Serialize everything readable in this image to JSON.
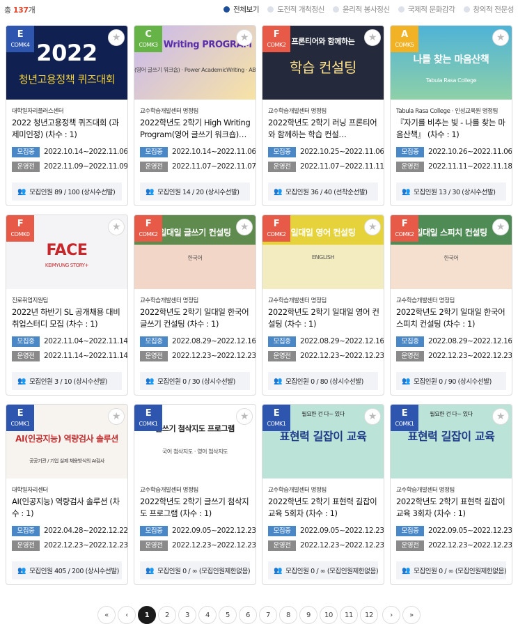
{
  "header": {
    "total_prefix": "총",
    "total_count": "137",
    "total_suffix": "개",
    "filters": [
      "전체보기",
      "도전적 개척정신",
      "윤리적 봉사정신",
      "국제적 문화감각",
      "창의적 전문성"
    ],
    "active_filter": 0
  },
  "labels": {
    "recruit": "모집중",
    "operate": "운영전",
    "count_prefix": "모집인원"
  },
  "colors": {
    "grade_E": "#2f56ae",
    "grade_C": "#66b347",
    "grade_F": "#e85a48",
    "grade_A": "#f2b226",
    "accent": "#e0452b",
    "active_dot": "#1d4e9a",
    "recruit_label": "#4a87c7",
    "operate_label": "#8a8a8a"
  },
  "icons": {
    "favorite": "star-icon",
    "person": "person-icon",
    "first": "double-chevron-left-icon",
    "prev": "chevron-left-icon",
    "next": "chevron-right-icon",
    "last": "double-chevron-right-icon"
  },
  "cards": [
    {
      "grade": "E",
      "code": "COMK4",
      "thumb": {
        "line1": "2022",
        "line2": "청년고용정책 퀴즈대회"
      },
      "org": "대학일자리플러스센터",
      "title": "2022 청년고용정책 퀴즈대회 (과제미인정) (차수 : 1)",
      "recruit": "2022.10.14~2022.11.06",
      "operate": "2022.11.09~2022.11.09",
      "count": "89 / 100 (상시수선발)"
    },
    {
      "grade": "C",
      "code": "COMK3",
      "thumb": {
        "line1": "High Writing PROGRAM",
        "line2": "(영어 글쓰기 워크숍) · Power AcademicWriting · ABCD"
      },
      "org": "교수학습개발센터 명정팀",
      "title": "2022학년도 2학기 High Writing Program(영어 글쓰기 워크숍)…",
      "recruit": "2022.10.14~2022.11.06",
      "operate": "2022.11.07~2022.11.07",
      "count": "14 / 20 (상시수선발)"
    },
    {
      "grade": "F",
      "code": "COMK2",
      "thumb": {
        "line1": "프론티어와 함께하는",
        "line2": "학습 컨설팅"
      },
      "org": "교수학습개발센터 명정팀",
      "title": "2022학년도 2학기 러닝 프론티어와 함께하는 학습 컨설…",
      "recruit": "2022.10.25~2022.11.06",
      "operate": "2022.11.07~2022.11.11",
      "count": "36 / 40 (선착순선발)"
    },
    {
      "grade": "A",
      "code": "COMK5",
      "thumb": {
        "line1": "나를 찾는 마음산책",
        "line2": "Tabula Rasa College"
      },
      "org": "Tabula Rasa College · 인성교육원 명정팀",
      "title": "『자기를 비추는 빛 - 나를 찾는 마음산책』 (차수 : 1)",
      "recruit": "2022.10.26~2022.11.06",
      "operate": "2022.11.11~2022.11.18",
      "count": "13 / 30 (상시수선발)"
    },
    {
      "grade": "F",
      "code": "COMK0",
      "thumb": {
        "line1": "FACE",
        "line2": "KEIMYUNG STORY+"
      },
      "org": "진로취업지원팀",
      "title": "2022년 하반기 SL 공개채용 대비 취업스터디 모집 (차수 : 1)",
      "recruit": "2022.11.04~2022.11.14",
      "operate": "2022.11.14~2022.11.14",
      "count": "3 / 10 (상시수선발)"
    },
    {
      "grade": "F",
      "code": "COMK2",
      "thumb": {
        "line1": "일대일 글쓰기 컨설팅",
        "line2": "한국어"
      },
      "org": "교수학습개발센터 명정팀",
      "title": "2022학년도 2학기 일대일 한국어 글쓰기 컨설팅 (차수 : 1)",
      "recruit": "2022.08.29~2022.12.16",
      "operate": "2022.12.23~2022.12.23",
      "count": "0 / 30 (상시수선발)"
    },
    {
      "grade": "F",
      "code": "COMK2",
      "thumb": {
        "line1": "일대일 영어 컨설팅",
        "line2": "ENGLISH"
      },
      "org": "교수학습개발센터 명정팀",
      "title": "2022학년도 2학기 일대일 영어 컨설팅 (차수 : 1)",
      "recruit": "2022.08.29~2022.12.16",
      "operate": "2022.12.23~2022.12.23",
      "count": "0 / 80 (상시수선발)"
    },
    {
      "grade": "F",
      "code": "COMK2",
      "thumb": {
        "line1": "일대일 스피치 컨설팅",
        "line2": "한국어"
      },
      "org": "교수학습개발센터 명정팀",
      "title": "2022학년도 2학기 일대일 한국어 스피치 컨설팅 (차수 : 1)",
      "recruit": "2022.08.29~2022.12.16",
      "operate": "2022.12.23~2022.12.23",
      "count": "0 / 90 (상시수선발)"
    },
    {
      "grade": "E",
      "code": "COMK1",
      "thumb": {
        "line1": "AI(인공지능) 역량검사 솔루션",
        "line2": "공공기관 / 기업 실제 채용방식의 AI검사"
      },
      "org": "대학일자리센터",
      "title": "AI(인공지능) 역량검사 솔루션 (차수 : 1)",
      "recruit": "2022.04.28~2022.12.22",
      "operate": "2022.12.23~2022.12.23",
      "count": "405 / 200 (상시수선발)"
    },
    {
      "grade": "E",
      "code": "COMK1",
      "thumb": {
        "line1": "글쓰기 첨삭지도 프로그램",
        "line2": "국어 첨삭지도 · 영어 첨삭지도"
      },
      "org": "교수학습개발센터 명정팀",
      "title": "2022학년도 2학기 글쓰기 첨삭지도 프로그램 (차수 : 1)",
      "recruit": "2022.09.05~2022.12.23",
      "operate": "2022.12.23~2022.12.23",
      "count": "0 / ∞ (모집인원제한없음)"
    },
    {
      "grade": "E",
      "code": "COMK1",
      "thumb": {
        "line1": "표현력 길잡이 교육",
        "line2": "필요한 건 다~ 있다"
      },
      "org": "교수학습개발센터 명정팀",
      "title": "2022학년도 2학기 표현력 길잡이 교육 5회차 (차수 : 1)",
      "recruit": "2022.09.05~2022.12.23",
      "operate": "2022.12.23~2022.12.23",
      "count": "0 / ∞ (모집인원제한없음)"
    },
    {
      "grade": "E",
      "code": "COMK1",
      "thumb": {
        "line1": "표현력 길잡이 교육",
        "line2": "필요한 건 다~ 있다"
      },
      "org": "교수학습개발센터 명정팀",
      "title": "2022학년도 2학기 표현력 길잡이 교육 3회차 (차수 : 1)",
      "recruit": "2022.09.05~2022.12.23",
      "operate": "2022.12.23~2022.12.23",
      "count": "0 / ∞ (모집인원제한없음)"
    }
  ],
  "pagination": {
    "first": "«",
    "prev": "‹",
    "pages": [
      "1",
      "2",
      "3",
      "4",
      "5",
      "6",
      "7",
      "8",
      "9",
      "10",
      "11",
      "12"
    ],
    "current": "1",
    "next": "›",
    "last": "»"
  }
}
